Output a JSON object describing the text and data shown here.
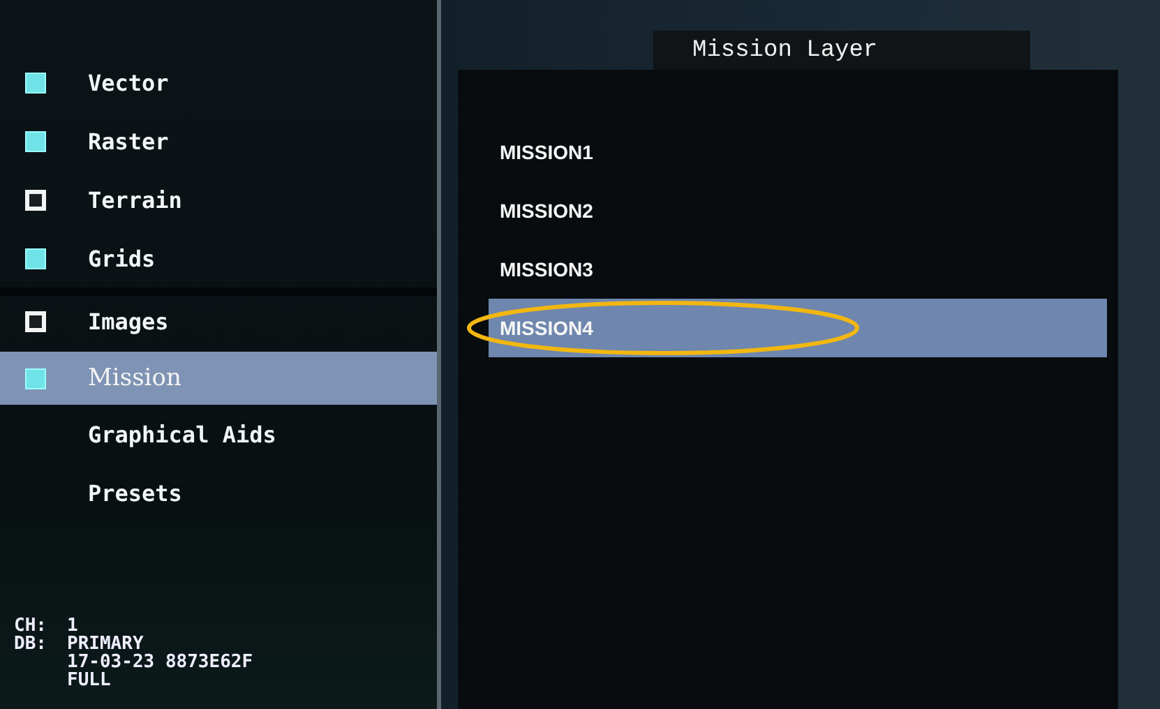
{
  "layers": [
    {
      "label": "Vector",
      "kind": "checkbox",
      "checked": true,
      "selected": false
    },
    {
      "label": "Raster",
      "kind": "checkbox",
      "checked": true,
      "selected": false
    },
    {
      "label": "Terrain",
      "kind": "checkbox",
      "checked": false,
      "selected": false
    },
    {
      "label": "Grids",
      "kind": "checkbox",
      "checked": true,
      "selected": false
    },
    {
      "label": "Images",
      "kind": "checkbox",
      "checked": false,
      "selected": false
    },
    {
      "label": "Mission",
      "kind": "checkbox",
      "checked": true,
      "selected": true
    },
    {
      "label": "Graphical Aids",
      "kind": "plain",
      "selected": false
    },
    {
      "label": "Presets",
      "kind": "plain",
      "selected": false
    }
  ],
  "status": [
    {
      "label": "CH:",
      "value": "1"
    },
    {
      "label": "DB:",
      "value": "PRIMARY"
    },
    {
      "value": "17-03-23 8873E62F"
    },
    {
      "value": "FULL"
    }
  ],
  "panel": {
    "title": "Mission Layer",
    "items": [
      {
        "label": "MISSION1",
        "selected": false,
        "circled": false
      },
      {
        "label": "MISSION2",
        "selected": false,
        "circled": false
      },
      {
        "label": "MISSION3",
        "selected": false,
        "circled": false
      },
      {
        "label": "MISSION4",
        "selected": true,
        "circled": true
      }
    ]
  }
}
